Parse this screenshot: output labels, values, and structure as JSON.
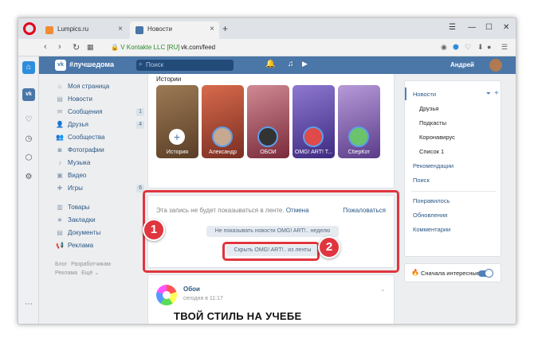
{
  "browser": {
    "tabs": [
      {
        "title": "Lumpics.ru",
        "active": false,
        "favicon_color": "#f28b33"
      },
      {
        "title": "Новости",
        "active": true,
        "favicon_color": "#4a76a8"
      }
    ],
    "security_label": "V Kontakte LLC [RU]",
    "url": "vk.com/feed"
  },
  "vk": {
    "header": {
      "hashtag": "#лучшедома",
      "search_placeholder": "Поиск",
      "user_name": "Андрей"
    },
    "left_nav": {
      "main": [
        {
          "label": "Моя страница",
          "icon": "home-icon",
          "count": ""
        },
        {
          "label": "Новости",
          "icon": "news-icon",
          "count": ""
        },
        {
          "label": "Сообщения",
          "icon": "messages-icon",
          "count": "1"
        },
        {
          "label": "Друзья",
          "icon": "friends-icon",
          "count": "4"
        },
        {
          "label": "Сообщества",
          "icon": "groups-icon",
          "count": ""
        },
        {
          "label": "Фотографии",
          "icon": "camera-icon",
          "count": ""
        },
        {
          "label": "Музыка",
          "icon": "music-icon",
          "count": ""
        },
        {
          "label": "Видео",
          "icon": "video-icon",
          "count": ""
        },
        {
          "label": "Игры",
          "icon": "games-icon",
          "count": "6"
        }
      ],
      "secondary": [
        {
          "label": "Товары",
          "icon": "goods-icon"
        },
        {
          "label": "Закладки",
          "icon": "bookmark-icon"
        },
        {
          "label": "Документы",
          "icon": "documents-icon"
        },
        {
          "label": "Реклама",
          "icon": "ads-icon"
        }
      ],
      "footer": {
        "blog": "Блог",
        "developers": "Разработчикам",
        "ads": "Реклама",
        "more": "Ещё ⌄"
      }
    },
    "stories": {
      "title": "Истории",
      "items": [
        {
          "name": "История",
          "color": "#7a5a3a"
        },
        {
          "name": "Александр",
          "color": "#c45a3e"
        },
        {
          "name": "ОБОИ",
          "color": "#b54a58"
        },
        {
          "name": "OMG! ART! T...",
          "color": "#6a4fb0"
        },
        {
          "name": "СберКот",
          "color": "#8a6ab0"
        }
      ]
    },
    "hidden_post": {
      "message": "Эта запись не будет показываться в ленте.",
      "cancel_label": "Отмена",
      "complain_label": "Пожаловаться",
      "hide_week_label": "Не показывать новости OMG! ART!.. неделю",
      "hide_feed_label": "Скрыть OMG! ART!.. из ленты"
    },
    "post": {
      "author": "Обои",
      "time": "сегодня в 11:17",
      "image_caption": "ТВОЙ СТИЛЬ НА УЧЕБЕ"
    },
    "right_menu": {
      "news": "Новости",
      "subs": [
        "Друзья",
        "Подкасты",
        "Коронавирус",
        "Список 1"
      ],
      "recommendations": "Рекомендации",
      "search": "Поиск",
      "liked": "Понравилось",
      "updates": "Обновления",
      "comments": "Комментарии"
    },
    "interesting_toggle": {
      "label": "Сначала интересные",
      "on": true
    }
  },
  "annotations": {
    "badge_1": "1",
    "badge_2": "2",
    "highlight_color": "#e0353e"
  }
}
